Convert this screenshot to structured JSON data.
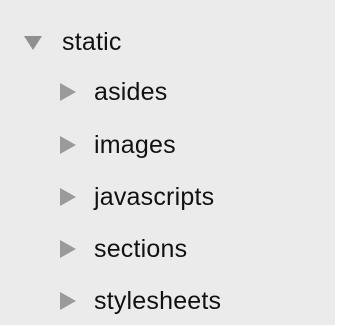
{
  "tree": {
    "root": {
      "label": "static",
      "icon": "triangle-down-icon"
    },
    "children": [
      {
        "label": "asides",
        "icon": "triangle-right-icon"
      },
      {
        "label": "images",
        "icon": "triangle-right-icon"
      },
      {
        "label": "javascripts",
        "icon": "triangle-right-icon"
      },
      {
        "label": "sections",
        "icon": "triangle-right-icon"
      },
      {
        "label": "stylesheets",
        "icon": "triangle-right-icon"
      }
    ]
  },
  "colors": {
    "panel_background": "#ebebeb",
    "text": "#111111",
    "disclosure_triangle": "#9a9a9a"
  }
}
